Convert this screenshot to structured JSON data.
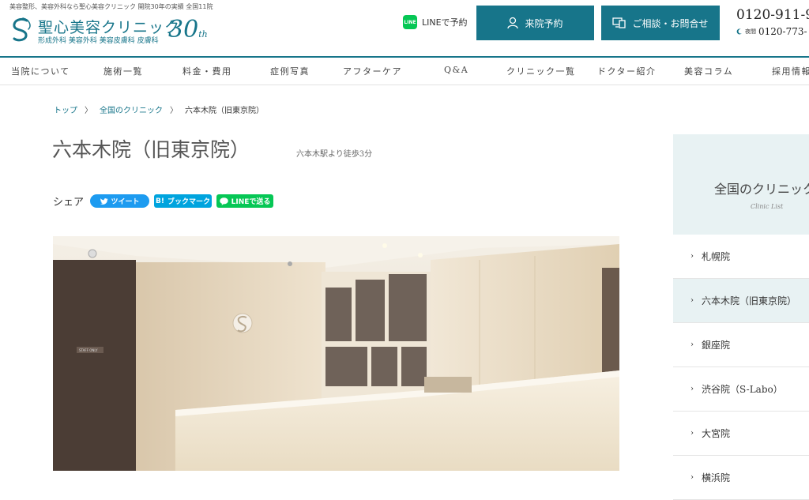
{
  "header": {
    "tagline": "美容整形、美容外科なら聖心美容クリニック 開院30年の実績 全国11院",
    "logo_name": "聖心美容クリニック",
    "logo_sub": "形成外科 美容外科 美容皮膚科 皮膚科",
    "logo_anniv": "30",
    "logo_anniv_suffix": "th",
    "line_label": "LINEで予約",
    "line_badge": "LINE",
    "reserve_label": "来院予約",
    "consult_label": "ご相談・お問合せ",
    "phone_day": "0120-911-9",
    "phone_night_label": "夜間",
    "phone_night": "0120-773-"
  },
  "nav": {
    "items": [
      "当院について",
      "施術一覧",
      "料金・費用",
      "症例写真",
      "アフターケア",
      "Q&A",
      "クリニック一覧",
      "ドクター紹介",
      "美容コラム",
      "採用情報"
    ]
  },
  "breadcrumb": {
    "items": [
      "トップ",
      "全国のクリニック",
      "六本木院（旧東京院）"
    ],
    "sep": "〉"
  },
  "page": {
    "title": "六本木院（旧東京院）",
    "access": "六本木駅より徒歩3分"
  },
  "share": {
    "label": "シェア",
    "tweet": "ツイート",
    "hatena": "ブックマーク",
    "hatena_mark": "B!",
    "line": "LINEで送る"
  },
  "photo": {
    "sign_text": "STAFF ONLY"
  },
  "sidebar": {
    "title": "全国のクリニック",
    "subtitle": "Clinic List",
    "items": [
      "札幌院",
      "六本木院（旧東京院）",
      "銀座院",
      "渋谷院（S-Labo）",
      "大宮院",
      "横浜院"
    ],
    "active_index": 1
  },
  "colors": {
    "brand": "#17758a",
    "line_green": "#06c755",
    "twitter_blue": "#1d9bf0",
    "hatena_blue": "#00a4de",
    "sidebar_bg": "#e8f2f3"
  }
}
